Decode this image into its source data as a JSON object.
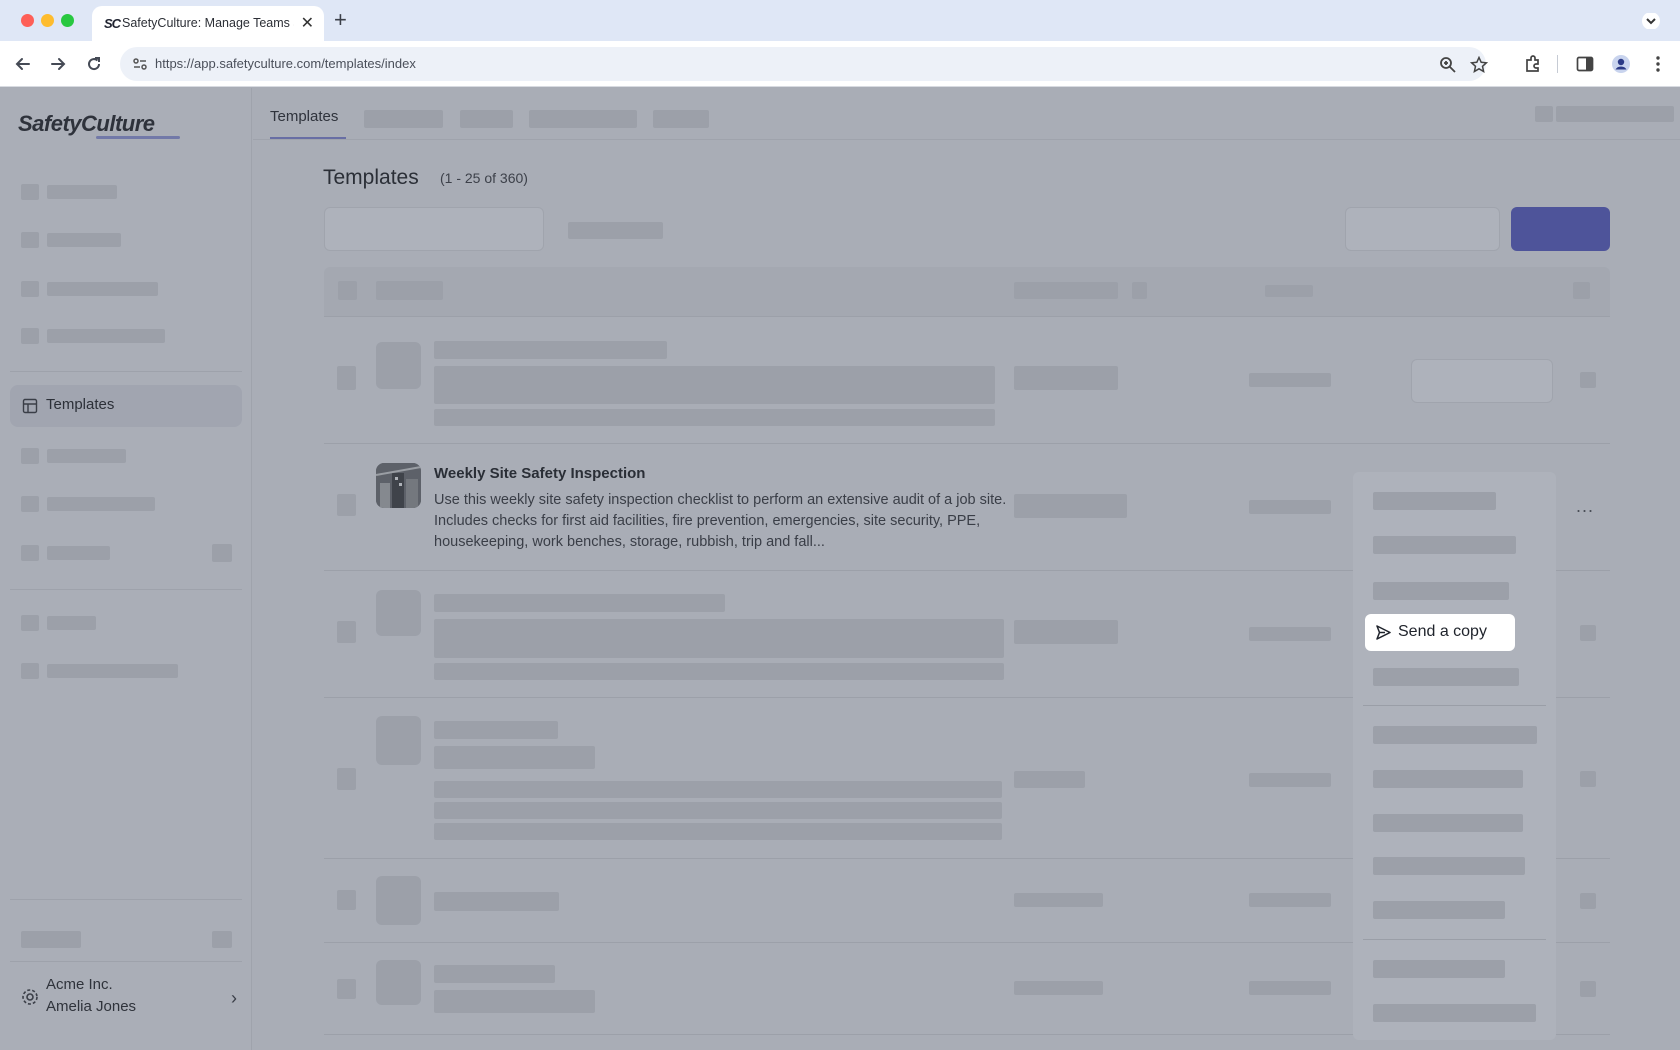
{
  "browser": {
    "tab_title": "SafetyCulture: Manage Teams and...",
    "tab_favicon": "SC",
    "url": "https://app.safetyculture.com/templates/index",
    "icons": [
      "back-icon",
      "forward-icon",
      "reload-icon",
      "site-info-icon",
      "zoom-icon",
      "bookmark-star-icon",
      "extensions-icon",
      "side-panel-icon",
      "profile-icon",
      "more-vert-icon"
    ]
  },
  "sidebar": {
    "logo": "SafetyCulture",
    "active_item": "Templates",
    "account": {
      "org": "Acme Inc.",
      "user": "Amelia Jones"
    }
  },
  "topnav": {
    "active_tab": "Templates"
  },
  "main": {
    "title": "Templates",
    "count": "(1 - 25 of 360)",
    "row": {
      "title": "Weekly Site Safety Inspection",
      "description": "Use this weekly site safety inspection checklist to perform an extensive audit of a job site. Includes checks for first aid facilities, fire prevention, emergencies, site security, PPE, housekeeping, work benches, storage, rubbish, trip and fall...",
      "more": "..."
    }
  },
  "menu": {
    "highlighted_item": "Send a copy"
  },
  "colors": {
    "overlay": "#a9adb6",
    "accent": "#3d4497",
    "highlight_bg": "#ffffff"
  }
}
